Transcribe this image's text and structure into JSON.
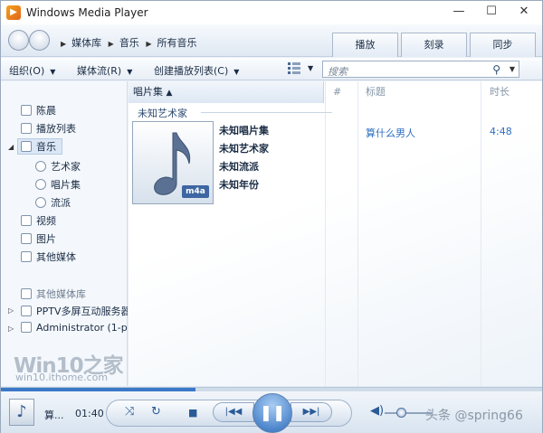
{
  "window": {
    "title": "Windows Media Player",
    "icon": "media-player-icon"
  },
  "nav": {
    "breadcrumbs": [
      "媒体库",
      "音乐",
      "所有音乐"
    ],
    "tabs": [
      "播放",
      "刻录",
      "同步"
    ]
  },
  "toolbar": {
    "organize": "组织(O)",
    "stream": "媒体流(R)",
    "create_playlist": "创建播放列表(C)",
    "search_placeholder": "搜索"
  },
  "sidebar": {
    "items": [
      {
        "label": "陈晨",
        "icon": "user-icon"
      },
      {
        "label": "播放列表",
        "icon": "playlist-icon"
      },
      {
        "label": "音乐",
        "icon": "music-icon",
        "selected": true
      },
      {
        "label": "艺术家",
        "icon": "artist-icon"
      },
      {
        "label": "唱片集",
        "icon": "album-icon"
      },
      {
        "label": "流派",
        "icon": "genre-icon"
      },
      {
        "label": "视频",
        "icon": "video-icon"
      },
      {
        "label": "图片",
        "icon": "picture-icon"
      },
      {
        "label": "其他媒体",
        "icon": "other-media-icon"
      },
      {
        "label": "其他媒体库",
        "icon": "other-library-icon"
      },
      {
        "label": "PPTV多屏互动服务器",
        "icon": "server-icon"
      },
      {
        "label": "Administrator (1-p",
        "icon": "server-icon"
      }
    ]
  },
  "content": {
    "columns": [
      "唱片集",
      "#",
      "标题",
      "时长"
    ],
    "group_header": "未知艺术家",
    "album": {
      "badge": "m4a",
      "name": "未知唱片集",
      "artist": "未知艺术家",
      "genre": "未知流派",
      "year": "未知年份"
    },
    "track": {
      "title": "算什么男人",
      "length": "4:48"
    }
  },
  "watermark": {
    "brand": "Win10之家",
    "url": "win10.ithome.com"
  },
  "player": {
    "now_playing": "算...",
    "time": "01:40",
    "progress": 0.36,
    "volume": 0.35
  },
  "credit": "头条 @spring66"
}
